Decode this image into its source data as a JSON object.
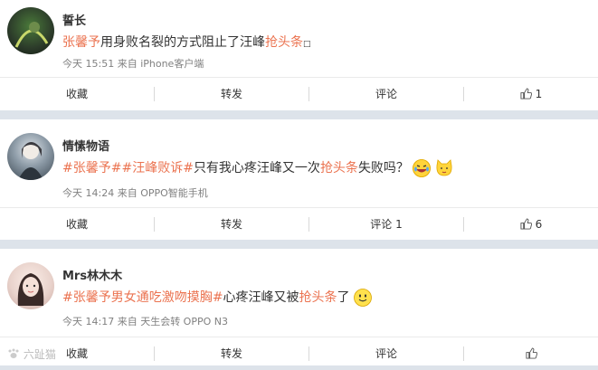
{
  "posts": [
    {
      "name": "誓长",
      "text_parts": [
        {
          "t": "张馨予",
          "hl": true
        },
        {
          "t": "用身败名裂的方式阻止了汪峰",
          "hl": false
        },
        {
          "t": "抢头条",
          "hl": true
        },
        {
          "t": "□",
          "hl": false
        }
      ],
      "meta": "今天 15:51 来自 iPhone客户端",
      "actions": {
        "fav": "收藏",
        "repost": "转发",
        "comment": "评论",
        "like": "1"
      }
    },
    {
      "name": "情愫物语",
      "text_parts": [
        {
          "t": "#张馨予#",
          "hl": true
        },
        {
          "t": "#汪峰败诉#",
          "hl": true
        },
        {
          "t": "只有我心疼汪峰又一次",
          "hl": false
        },
        {
          "t": "抢头条",
          "hl": true
        },
        {
          "t": "失败吗？",
          "hl": false
        }
      ],
      "meta": "今天 14:24 来自 OPPO智能手机",
      "actions": {
        "fav": "收藏",
        "repost": "转发",
        "comment": "评论 1",
        "like": "6"
      }
    },
    {
      "name": "Mrs林木木",
      "text_parts": [
        {
          "t": "#张馨予男女通吃激吻摸胸#",
          "hl": true
        },
        {
          "t": "心疼汪峰又被",
          "hl": false
        },
        {
          "t": "抢头条",
          "hl": true
        },
        {
          "t": "了",
          "hl": false
        }
      ],
      "meta": "今天 14:17 来自 天生会转 OPPO N3",
      "actions": {
        "fav": "收藏",
        "repost": "转发",
        "comment": "评论",
        "like": ""
      }
    }
  ],
  "watermark": "六趾猫",
  "icons": {
    "like": "thumbs-up-icon",
    "emoji_laugh": "laugh-emoji",
    "emoji_cat": "cat-emoji",
    "emoji_smile": "smile-emoji"
  }
}
